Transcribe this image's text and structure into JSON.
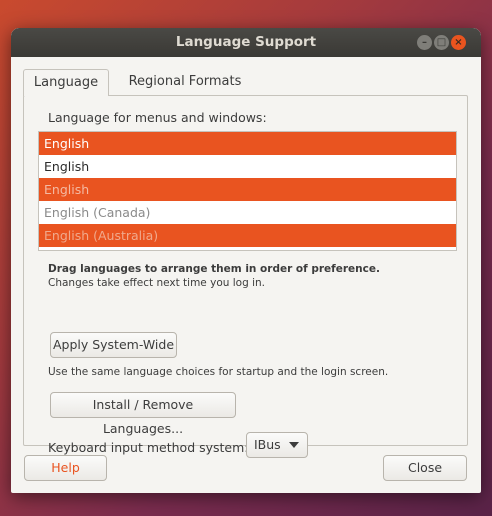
{
  "window": {
    "title": "Language Support"
  },
  "tabs": [
    {
      "label": "Language"
    },
    {
      "label": "Regional Formats"
    }
  ],
  "language_tab": {
    "list_heading": "Language for menus and windows:",
    "languages": [
      {
        "label": "English",
        "style": "selected"
      },
      {
        "label": "English",
        "style": "normal"
      },
      {
        "label": "English",
        "style": "faded-selected"
      },
      {
        "label": "English (Canada)",
        "style": "faded"
      },
      {
        "label": "English (Australia)",
        "style": "faded-selected"
      }
    ],
    "drag_hint": "Drag languages to arrange them in order of preference.",
    "changes_hint": "Changes take effect next time you log in.",
    "apply_button": "Apply System-Wide",
    "apply_hint": "Use the same language choices for startup and the login screen.",
    "install_button": "Install / Remove Languages...",
    "keyboard_label": "Keyboard input method system:",
    "keyboard_value": "IBus"
  },
  "footer": {
    "help_button": "Help",
    "close_button": "Close"
  },
  "colors": {
    "accent": "#e95420",
    "window_bg": "#f5f4f1",
    "titlebar_bg": "#3e3d39"
  }
}
